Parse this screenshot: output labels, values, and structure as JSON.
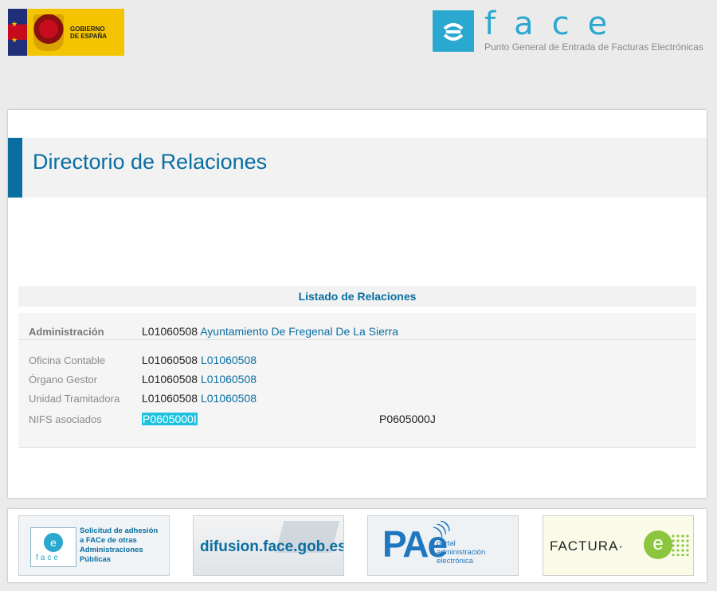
{
  "header": {
    "gov_logo_text": [
      "GOBIERNO",
      "DE ESPAÑA"
    ],
    "face_brand": "face",
    "face_subtitle": "Punto General de Entrada de Facturas Electrónicas"
  },
  "page": {
    "title": "Directorio de Relaciones",
    "list_title": "Listado de Relaciones"
  },
  "relations": {
    "administracion": {
      "label": "Administración",
      "code": "L01060508",
      "name": "Ayuntamiento De Fregenal De La Sierra"
    },
    "oficina_contable": {
      "label": "Oficina Contable",
      "code": "L01060508",
      "name": "L01060508"
    },
    "organo_gestor": {
      "label": "Órgano Gestor",
      "code": "L01060508",
      "name": "L01060508"
    },
    "unidad_tramitadora": {
      "label": "Unidad Tramitadora",
      "code": "L01060508",
      "name": "L01060508"
    },
    "nifs": {
      "label": "NIFS asociados",
      "values": [
        "P0605000I",
        "P0605000J"
      ]
    }
  },
  "footer": {
    "banner1": [
      "Solicitud de adhesión",
      "a FACe de otras",
      "Administraciones",
      "Públicas"
    ],
    "banner1_mini": "face",
    "banner2": "difusion.face.gob.es",
    "banner3_logo": "PAe",
    "banner3": [
      "portal",
      "administración",
      "electrónica"
    ],
    "banner4": "FACTURA·",
    "banner4_e": "e"
  },
  "colors": {
    "accent": "#0a6ea0",
    "face_blue": "#2aa8cf",
    "selection": "#1ec3e0"
  }
}
